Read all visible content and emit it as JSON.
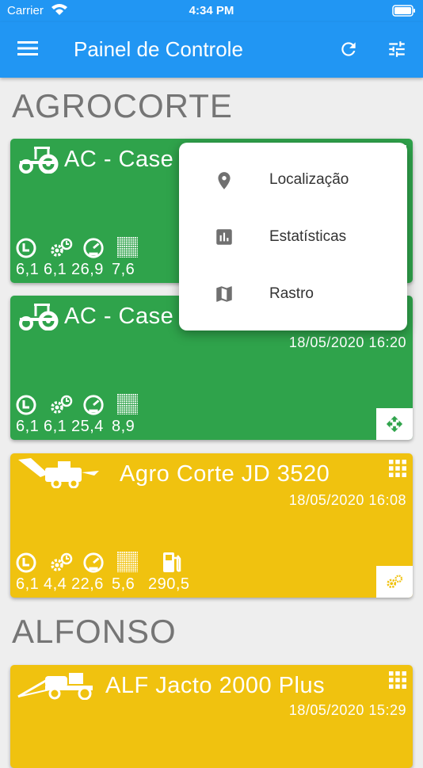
{
  "statusbar": {
    "carrier": "Carrier",
    "time": "4:34 PM"
  },
  "appbar": {
    "title": "Painel de Controle"
  },
  "groups": [
    {
      "title": "AGROCORTE"
    },
    {
      "title": "ALFONSO"
    }
  ],
  "cards": [
    {
      "name": "AC - Case",
      "date": "",
      "color": "#2fa34b",
      "metrics": [
        "6,1",
        "6,1",
        "26,9",
        "7,6"
      ]
    },
    {
      "name": "AC - Case",
      "date": "18/05/2020 16:20",
      "color": "#2fa34b",
      "metrics": [
        "6,1",
        "6,1",
        "25,4",
        "8,9"
      ],
      "corner_icon": "move-icon"
    },
    {
      "name": "Agro Corte JD 3520",
      "date": "18/05/2020 16:08",
      "color": "#f0c20f",
      "metrics": [
        "6,1",
        "4,4",
        "22,6",
        "5,6",
        "290,5"
      ],
      "corner_icon": "gears-icon"
    },
    {
      "name": "ALF Jacto 2000 Plus",
      "date": "18/05/2020 15:29",
      "color": "#f0c20f"
    }
  ],
  "popup_menu": {
    "items": [
      {
        "label": "Localização",
        "icon": "location-pin-icon"
      },
      {
        "label": "Estatísticas",
        "icon": "bar-chart-icon"
      },
      {
        "label": "Rastro",
        "icon": "map-icon"
      }
    ]
  },
  "colors": {
    "primary": "#2196f3",
    "green": "#2fa34b",
    "yellow": "#f0c20f",
    "background": "#eeeeee"
  }
}
